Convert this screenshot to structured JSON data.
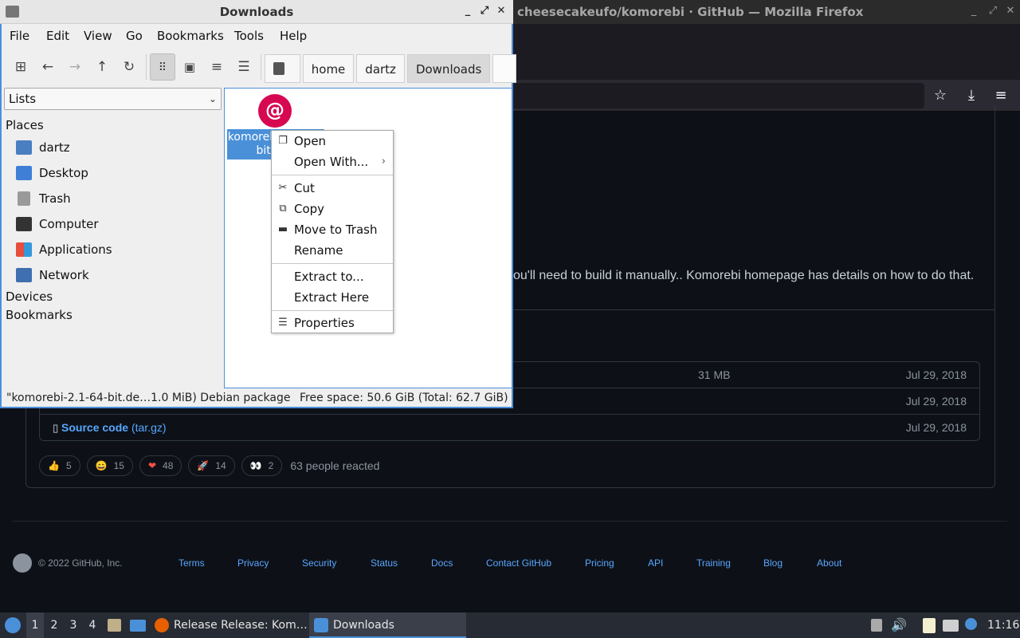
{
  "firefox": {
    "title": "cheesecakeufo/komorebi · GitHub — Mozilla Firefox"
  },
  "github": {
    "note": "ou'll need to build it manually.. Komorebi homepage has details on how to do that.",
    "assets": [
      {
        "name": "",
        "paren": "",
        "size": "31 MB",
        "date": "Jul 29, 2018"
      },
      {
        "name": "",
        "paren": "",
        "size": "",
        "date": "Jul 29, 2018"
      },
      {
        "name": "Source code",
        "paren": "(tar.gz)",
        "size": "",
        "date": "Jul 29, 2018"
      }
    ],
    "reactions": [
      {
        "emoji": "👍",
        "count": "5"
      },
      {
        "emoji": "😄",
        "count": "15"
      },
      {
        "emoji": "❤",
        "count": "48"
      },
      {
        "emoji": "🚀",
        "count": "14"
      },
      {
        "emoji": "👀",
        "count": "2"
      }
    ],
    "reacted_text": "63 people reacted",
    "footer": {
      "copyright": "© 2022 GitHub, Inc.",
      "links": [
        "Terms",
        "Privacy",
        "Security",
        "Status",
        "Docs",
        "Contact GitHub",
        "Pricing",
        "API",
        "Training",
        "Blog",
        "About"
      ]
    }
  },
  "file_manager": {
    "title": "Downloads",
    "menu": [
      "File",
      "Edit",
      "View",
      "Go",
      "Bookmarks",
      "Tools",
      "Help"
    ],
    "path": [
      "/",
      "home",
      "dartz",
      "Downloads"
    ],
    "side_mode": "Lists",
    "places_heading": "Places",
    "places": [
      "dartz",
      "Desktop",
      "Trash",
      "Computer",
      "Applications",
      "Network"
    ],
    "devices_heading": "Devices",
    "bookmarks_heading": "Bookmarks",
    "file_label": "komorebi-2.1-64-bit.deb",
    "status_left": "\"komorebi-2.1-64-bit.de…1.0 MiB) Debian package",
    "status_right": "Free space: 50.6 GiB (Total: 62.7 GiB)"
  },
  "context_menu": {
    "open": "Open",
    "open_with": "Open With...",
    "cut": "Cut",
    "copy": "Copy",
    "move_to_trash": "Move to Trash",
    "rename": "Rename",
    "extract_to": "Extract to...",
    "extract_here": "Extract Here",
    "properties": "Properties"
  },
  "taskbar": {
    "desktops": [
      "1",
      "2",
      "3",
      "4"
    ],
    "tasks": [
      "Release Release: Kom…",
      "Downloads"
    ],
    "clock": "11:16"
  },
  "colors": {
    "accent": "#4a90d9",
    "github_bg": "#0d1117",
    "link": "#58a6ff",
    "debian": "#d70751"
  }
}
